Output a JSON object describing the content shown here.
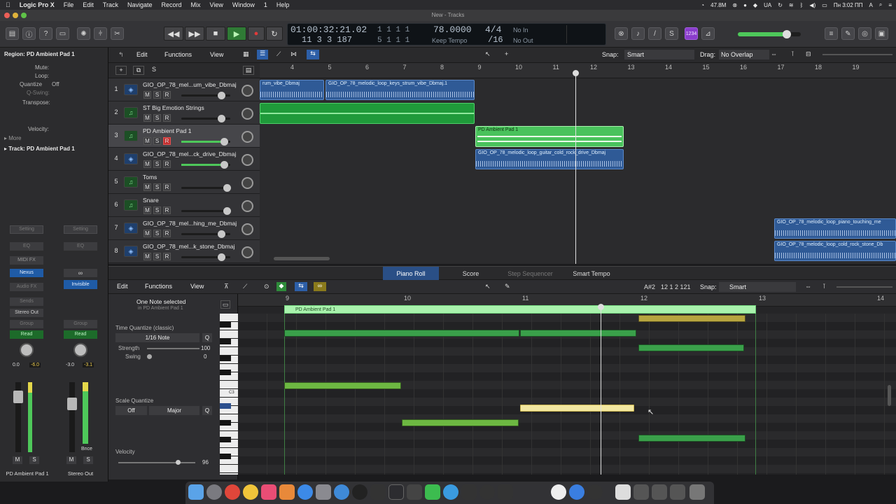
{
  "menubar": {
    "apple": "",
    "app": "Logic Pro X",
    "items": [
      "File",
      "Edit",
      "Track",
      "Navigate",
      "Record",
      "Mix",
      "View",
      "Window",
      "1",
      "Help"
    ],
    "mem": "47.8M",
    "lang": "UA",
    "clock": "Пн 3:02 ПП"
  },
  "window": {
    "title": "New - Tracks"
  },
  "lcd": {
    "time": "01:00:32:21.02",
    "bars": "1  1  1     1",
    "bars2": "11  3  3  187",
    "bars3": "5  1  1     1",
    "tempo": "78.0000",
    "tempo_mode": "Keep Tempo",
    "sig": "4/4",
    "div": "/16",
    "in": "No In",
    "out": "No Out"
  },
  "ctrl": {
    "key_badge": "1234"
  },
  "inspector": {
    "region": "Region: PD Ambient Pad 1",
    "mute": "Mute:",
    "loop": "Loop:",
    "quantize": "Quantize",
    "quantize_val": "Off",
    "qswing": "Q-Swing:",
    "transpose": "Transpose:",
    "velocity": "Velocity:",
    "more": "More",
    "track": "Track:  PD Ambient Pad 1",
    "ch1": {
      "setting": "Setting",
      "eq": "EQ",
      "midifx": "MIDI FX",
      "inst": "Nexus",
      "audiofx": "Audio FX",
      "sends": "Sends",
      "out": "Stereo Out",
      "group": "Group",
      "auto": "Read",
      "vol": "0.0",
      "pk": "-6.0",
      "name": "PD Ambient Pad 1"
    },
    "ch2": {
      "setting": "Setting",
      "eq": "EQ",
      "inst": "Invisible",
      "group": "Group",
      "auto": "Read",
      "vol": "-3.0",
      "pk": "-3.1",
      "bnce": "Bnce",
      "name": "Stereo Out"
    },
    "m": "M",
    "s": "S"
  },
  "arrange_menu": {
    "edit": "Edit",
    "functions": "Functions",
    "view": "View",
    "snap": "Snap:",
    "snap_val": "Smart",
    "drag": "Drag:",
    "drag_val": "No Overlap"
  },
  "ruler": [
    "4",
    "5",
    "6",
    "7",
    "8",
    "9",
    "10",
    "11",
    "12",
    "13",
    "14",
    "15",
    "16",
    "17",
    "18",
    "19"
  ],
  "tracks": [
    {
      "n": "1",
      "name": "GIO_OP_78_mel...um_vibe_Dbmaj",
      "type": "audio"
    },
    {
      "n": "2",
      "name": "ST Big Emotion Strings",
      "type": "midi"
    },
    {
      "n": "3",
      "name": "PD Ambient Pad 1",
      "type": "midi"
    },
    {
      "n": "4",
      "name": "GIO_OP_78_mel...ck_drive_Dbmaj",
      "type": "audio"
    },
    {
      "n": "5",
      "name": "Toms",
      "type": "midi"
    },
    {
      "n": "6",
      "name": "Snare",
      "type": "midi"
    },
    {
      "n": "7",
      "name": "GIO_OP_78_mel...hing_me_Dbmaj",
      "type": "audio"
    },
    {
      "n": "8",
      "name": "GIO_OP_78_mel...k_stone_Dbmaj",
      "type": "audio"
    }
  ],
  "regions": {
    "r1a": "rum_vibe_Dbmaj",
    "r1b": "GIO_OP_78_melodic_loop_keys_strum_vibe_Dbmaj.1",
    "r3": "PD Ambient Pad 1",
    "r4": "GIO_OP_78_melodic_loop_guitar_cold_rock_drive_Dbmaj",
    "r7": "GIO_OP_78_melodic_loop_piano_touching_me",
    "r8": "GIO_OP_78_melodic_loop_cold_rock_stone_Db"
  },
  "tabs": {
    "piano": "Piano Roll",
    "score": "Score",
    "step": "Step Sequencer",
    "tempo": "Smart Tempo"
  },
  "pr": {
    "edit": "Edit",
    "functions": "Functions",
    "view": "View",
    "pos_note": "A#2",
    "pos": "12 1 2 121",
    "snap": "Snap:",
    "snap_val": "Smart",
    "selected": "One Note selected",
    "selected_sub": "in PD Ambient Pad 1",
    "tq": "Time Quantize (classic)",
    "tq_val": "1/16 Note",
    "strength": "Strength",
    "strength_val": "100",
    "swing": "Swing",
    "swing_val": "0",
    "sq": "Scale Quantize",
    "sq_off": "Off",
    "sq_scale": "Major",
    "velocity": "Velocity",
    "velocity_val": "96",
    "q": "Q",
    "region": "PD Ambient Pad 1",
    "c3": "C3",
    "ruler": [
      "9",
      "10",
      "11",
      "12",
      "13",
      "14"
    ]
  },
  "notes": [
    {
      "x": 0.07,
      "y": 56,
      "w": 335,
      "c": "#3ea646"
    },
    {
      "x": 0.07,
      "y": 56,
      "w": 165,
      "c": "#3ea646"
    },
    {
      "x": 0,
      "y": 0,
      "w": 0,
      "c": ""
    }
  ]
}
